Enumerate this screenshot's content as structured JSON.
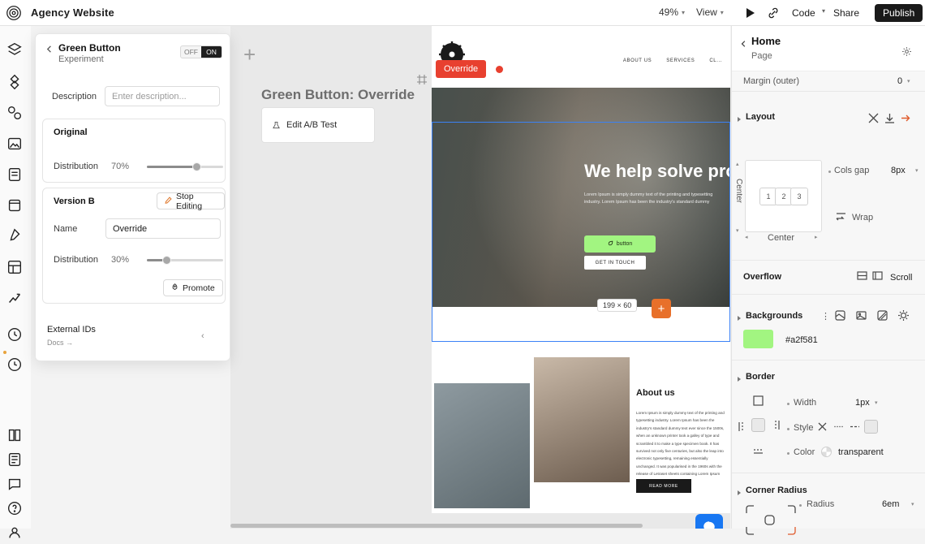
{
  "topbar": {
    "site_title": "Agency Website",
    "zoom": "49%",
    "view_label": "View",
    "code_label": "Code",
    "share_label": "Share",
    "publish_label": "Publish",
    "icons": {
      "logo": "spiral-logo-icon",
      "play": "play-icon",
      "link": "link-icon",
      "zoom_caret": "chevron-down-icon",
      "view_caret": "chevron-down-icon",
      "code_caret": "chevron-down-icon"
    }
  },
  "rail": {
    "items": [
      {
        "name": "layers-icon"
      },
      {
        "name": "components-icon"
      },
      {
        "name": "assets-icon"
      },
      {
        "name": "images-icon"
      },
      {
        "name": "pages-icon"
      },
      {
        "name": "library-icon"
      },
      {
        "name": "pen-tool-icon"
      },
      {
        "name": "cms-icon"
      },
      {
        "name": "analytics-icon"
      },
      {
        "name": "clock-icon"
      },
      {
        "name": "history-icon"
      },
      {
        "name": "book-icon"
      },
      {
        "name": "docs-icon"
      },
      {
        "name": "chat-icon"
      },
      {
        "name": "help-icon"
      },
      {
        "name": "account-icon"
      }
    ]
  },
  "experiment_panel": {
    "title": "Green Button",
    "subtitle": "Experiment",
    "toggle": {
      "off": "OFF",
      "on": "ON",
      "selected": "ON"
    },
    "description": {
      "label": "Description",
      "placeholder": "Enter description...",
      "value": ""
    },
    "original": {
      "title": "Original",
      "distribution_label": "Distribution",
      "distribution_value": "70%"
    },
    "version_b": {
      "title": "Version B",
      "stop_editing_label": "Stop Editing",
      "name_label": "Name",
      "name_value": "Override",
      "distribution_label": "Distribution",
      "distribution_value": "30%",
      "promote_label": "Promote"
    },
    "external_ids": {
      "label": "External IDs",
      "docs_label": "Docs →"
    }
  },
  "canvas": {
    "override_badge": "Override",
    "overlay_title": "Green Button: Override",
    "ab_test_label": "Edit A/B Test",
    "size_chip": "199 × 60",
    "plus_chip": "+",
    "website": {
      "nav_links": [
        "ABOUT US",
        "SERVICES",
        "CL..."
      ],
      "hero_heading": "We help solve probl",
      "hero_paragraph": "Lorem Ipsum is simply dummy text of the printing and typesetting industry. Lorem Ipsum has been the industry's standard dummy",
      "hero_button": "button",
      "hero_button_secondary": "GET IN TOUCH",
      "about_heading": "About us",
      "about_paragraph": "Lorem Ipsum is simply dummy text of the printing and typesetting industry. Lorem Ipsum has been the industry's standard dummy text ever since the 1500s, when an unknown printer took a galley of type and scrambled it to make a type specimen book. It has survived not only five centuries, but also the leap into electronic typesetting, remaining essentially unchanged. It was popularised in the 1960s with the release of Letraset sheets containing Lorem Ipsum passages.",
      "about_button": "READ MORE"
    }
  },
  "inspector": {
    "title": "Home",
    "subtitle": "Page",
    "margin": {
      "label": "Margin (outer)",
      "value": "0"
    },
    "layout": {
      "title": "Layout",
      "cols_gap_label": "Cols gap",
      "cols_gap_value": "8px",
      "wrap_label": "Wrap",
      "align_label": "Center",
      "align_vertical": "Center",
      "cells": [
        "1",
        "2",
        "3"
      ]
    },
    "overflow": {
      "title": "Overflow",
      "value": "Scroll"
    },
    "backgrounds": {
      "title": "Backgrounds",
      "color_value": "#a2f581"
    },
    "border": {
      "title": "Border",
      "width_label": "Width",
      "width_value": "1px",
      "style_label": "Style",
      "color_label": "Color",
      "color_value": "transparent"
    },
    "corner_radius": {
      "title": "Corner Radius",
      "radius_label": "Radius",
      "radius_value": "6em"
    }
  }
}
